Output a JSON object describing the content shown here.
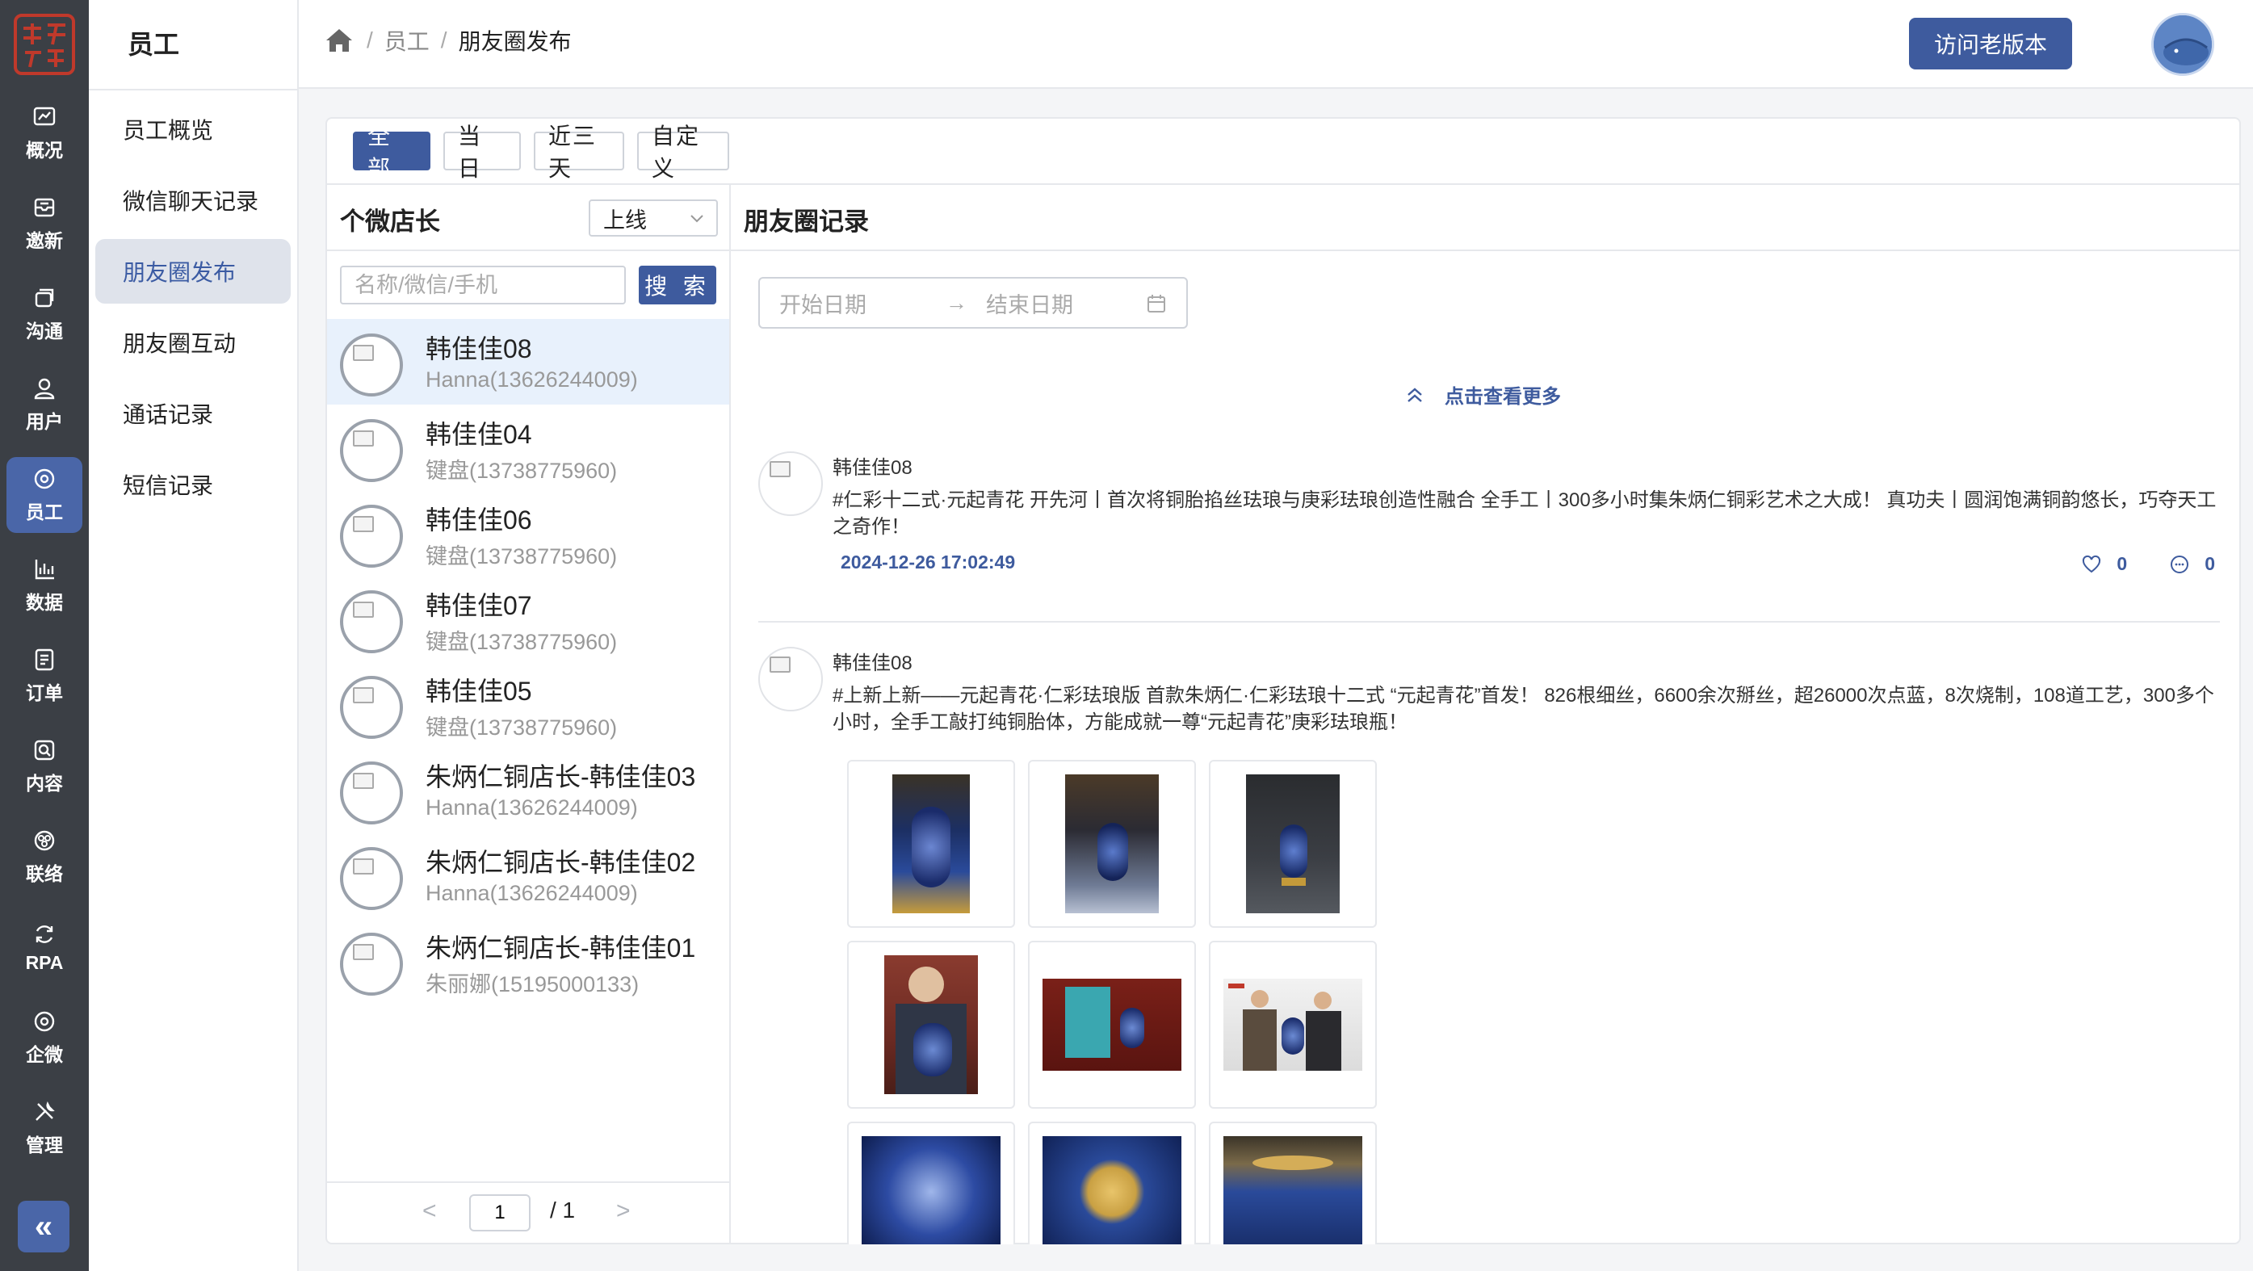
{
  "rail": {
    "items": [
      {
        "label": "概况",
        "icon": "chart-icon"
      },
      {
        "label": "邀新",
        "icon": "invite-icon"
      },
      {
        "label": "沟通",
        "icon": "chat-icon"
      },
      {
        "label": "用户",
        "icon": "user-icon"
      },
      {
        "label": "员工",
        "icon": "staff-icon"
      },
      {
        "label": "数据",
        "icon": "bar-chart-icon"
      },
      {
        "label": "订单",
        "icon": "order-icon"
      },
      {
        "label": "内容",
        "icon": "content-icon"
      },
      {
        "label": "联络",
        "icon": "contact-icon"
      },
      {
        "label": "RPA",
        "icon": "rpa-icon"
      },
      {
        "label": "企微",
        "icon": "wecom-icon"
      },
      {
        "label": "管理",
        "icon": "tools-icon"
      }
    ],
    "active": "员工",
    "collapse_label": "«",
    "accent": "#4a66a8"
  },
  "submenu": {
    "title": "员工",
    "items": [
      "员工概览",
      "微信聊天记录",
      "朋友圈发布",
      "朋友圈互动",
      "通话记录",
      "短信记录"
    ],
    "active": "朋友圈发布"
  },
  "header": {
    "breadcrumb": [
      "员工",
      "朋友圈发布"
    ],
    "old_version_label": "访问老版本"
  },
  "filters": {
    "buttons": [
      "全 部",
      "当 日",
      "近三天",
      "自定义"
    ],
    "active": "全 部"
  },
  "staff_panel": {
    "title": "个微店长",
    "status_value": "上线",
    "search_placeholder": "名称/微信/手机",
    "search_label": "搜 索",
    "items": [
      {
        "name": "韩佳佳08",
        "sub": "Hanna(13626244009)"
      },
      {
        "name": "韩佳佳04",
        "sub": "键盘(13738775960)"
      },
      {
        "name": "韩佳佳06",
        "sub": "键盘(13738775960)"
      },
      {
        "name": "韩佳佳07",
        "sub": "键盘(13738775960)"
      },
      {
        "name": "韩佳佳05",
        "sub": "键盘(13738775960)"
      },
      {
        "name": "朱炳仁铜店长-韩佳佳03",
        "sub": "Hanna(13626244009)"
      },
      {
        "name": "朱炳仁铜店长-韩佳佳02",
        "sub": "Hanna(13626244009)"
      },
      {
        "name": "朱炳仁铜店长-韩佳佳01",
        "sub": "朱丽娜(15195000133)"
      }
    ],
    "pager": {
      "prev": "<",
      "current": "1",
      "total": "/ 1",
      "next": ">"
    }
  },
  "records": {
    "title": "朋友圈记录",
    "date_start_placeholder": "开始日期",
    "date_arrow": "→",
    "date_end_placeholder": "结束日期",
    "more_label": "点击查看更多",
    "posts": [
      {
        "author": "韩佳佳08",
        "text": "#仁彩十二式·元起青花 开先河丨首次将铜胎掐丝珐琅与庚彩珐琅创造性融合 全手工丨300多小时集朱炳仁铜彩艺术之大成！ 真功夫丨圆润饱满铜韵悠长，巧夺天工之奇作！",
        "time": "2024-12-26 17:02:49",
        "likes": "0",
        "comments": "0"
      },
      {
        "author": "韩佳佳08",
        "text": "#上新上新——元起青花·仁彩珐琅版 首款朱炳仁·仁彩珐琅十二式 “元起青花”首发！ 826根细丝，6600余次掰丝，超26000次点蓝，8次烧制，108道工艺，300多个小时，全手工敲打纯铜胎体，方能成就一尊“元起青花”庚彩珐琅瓶！"
      }
    ]
  }
}
